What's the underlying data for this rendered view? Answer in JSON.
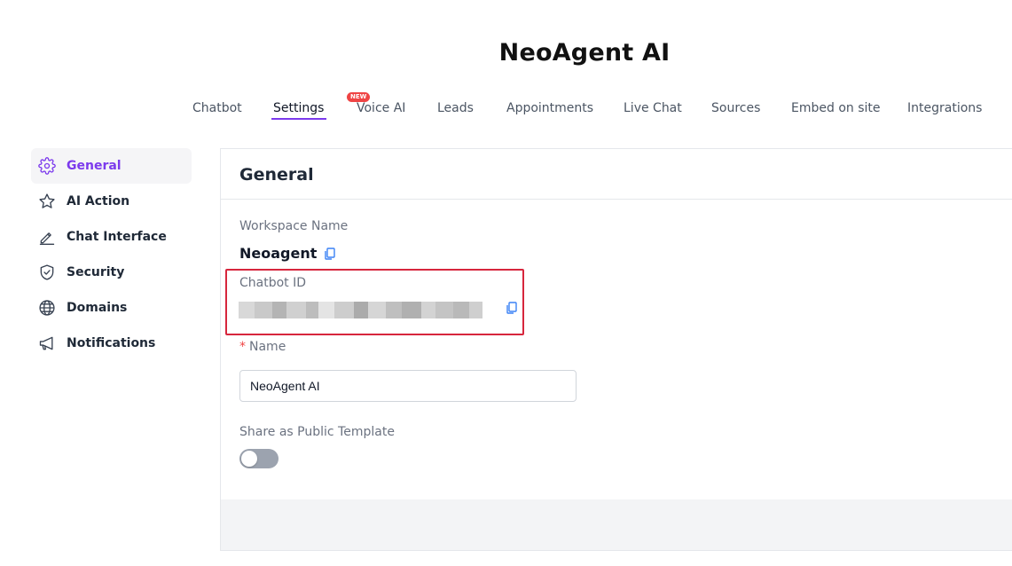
{
  "app_title": "NeoAgent AI",
  "colors": {
    "accent": "#7c3aed",
    "badge": "#ef4444",
    "highlight": "#d7263d",
    "copy_icon": "#3b82f6"
  },
  "tabs": [
    {
      "label": "Chatbot",
      "active": false
    },
    {
      "label": "Settings",
      "active": true
    },
    {
      "label": "Voice AI",
      "active": false,
      "badge": "NEW"
    },
    {
      "label": "Leads",
      "active": false
    },
    {
      "label": "Appointments",
      "active": false
    },
    {
      "label": "Live Chat",
      "active": false
    },
    {
      "label": "Sources",
      "active": false
    },
    {
      "label": "Embed on site",
      "active": false
    },
    {
      "label": "Integrations",
      "active": false
    }
  ],
  "sidebar": {
    "items": [
      {
        "label": "General",
        "icon": "gear-icon",
        "active": true
      },
      {
        "label": "AI Action",
        "icon": "star-icon",
        "active": false
      },
      {
        "label": "Chat Interface",
        "icon": "pencil-icon",
        "active": false
      },
      {
        "label": "Security",
        "icon": "shield-check-icon",
        "active": false
      },
      {
        "label": "Domains",
        "icon": "globe-icon",
        "active": false
      },
      {
        "label": "Notifications",
        "icon": "megaphone-icon",
        "active": false
      }
    ]
  },
  "panel": {
    "title": "General",
    "workspace_label": "Workspace Name",
    "workspace_value": "Neoagent",
    "chatbot_id_label": "Chatbot ID",
    "name_required_marker": "*",
    "name_label": "Name",
    "name_value": "NeoAgent AI",
    "template_label": "Share as Public Template",
    "template_toggle_on": false
  }
}
